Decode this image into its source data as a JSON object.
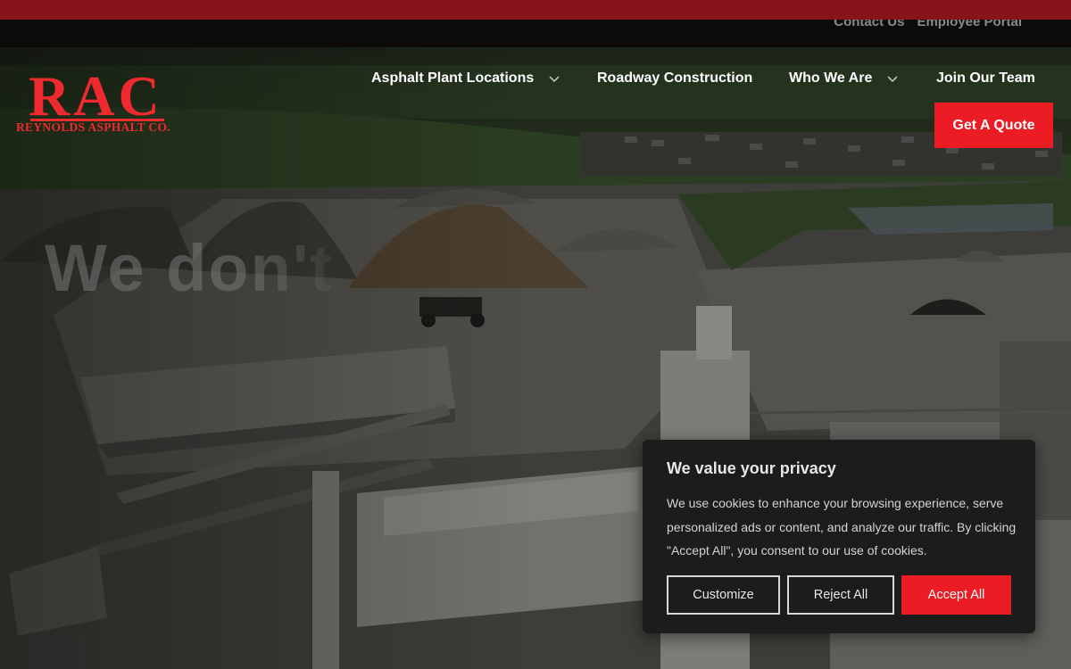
{
  "utility": {
    "links": [
      "Contact Us",
      "Employee Portal"
    ]
  },
  "brand": {
    "letters": "RAC",
    "name": "REYNOLDS ASPHALT CO.",
    "color": "#ec1c24"
  },
  "nav": {
    "items": [
      {
        "label": "Asphalt Plant Locations",
        "has_dropdown": true
      },
      {
        "label": "Roadway Construction",
        "has_dropdown": false
      },
      {
        "label": "Who We Are",
        "has_dropdown": true
      },
      {
        "label": "Join Our Team",
        "has_dropdown": false
      }
    ],
    "cta_label": "Get A Quote"
  },
  "hero": {
    "headline": "We don't"
  },
  "cookie": {
    "title": "We value your privacy",
    "body": "We use cookies to enhance your browsing experience, serve personalized ads or content, and analyze our traffic. By clicking \"Accept All\", you consent to our use of cookies.",
    "customize_label": "Customize",
    "reject_label": "Reject All",
    "accept_label": "Accept All"
  },
  "colors": {
    "accent": "#ec1c24",
    "top_bar": "#86141a",
    "modal_bg": "#1c1c1c"
  }
}
